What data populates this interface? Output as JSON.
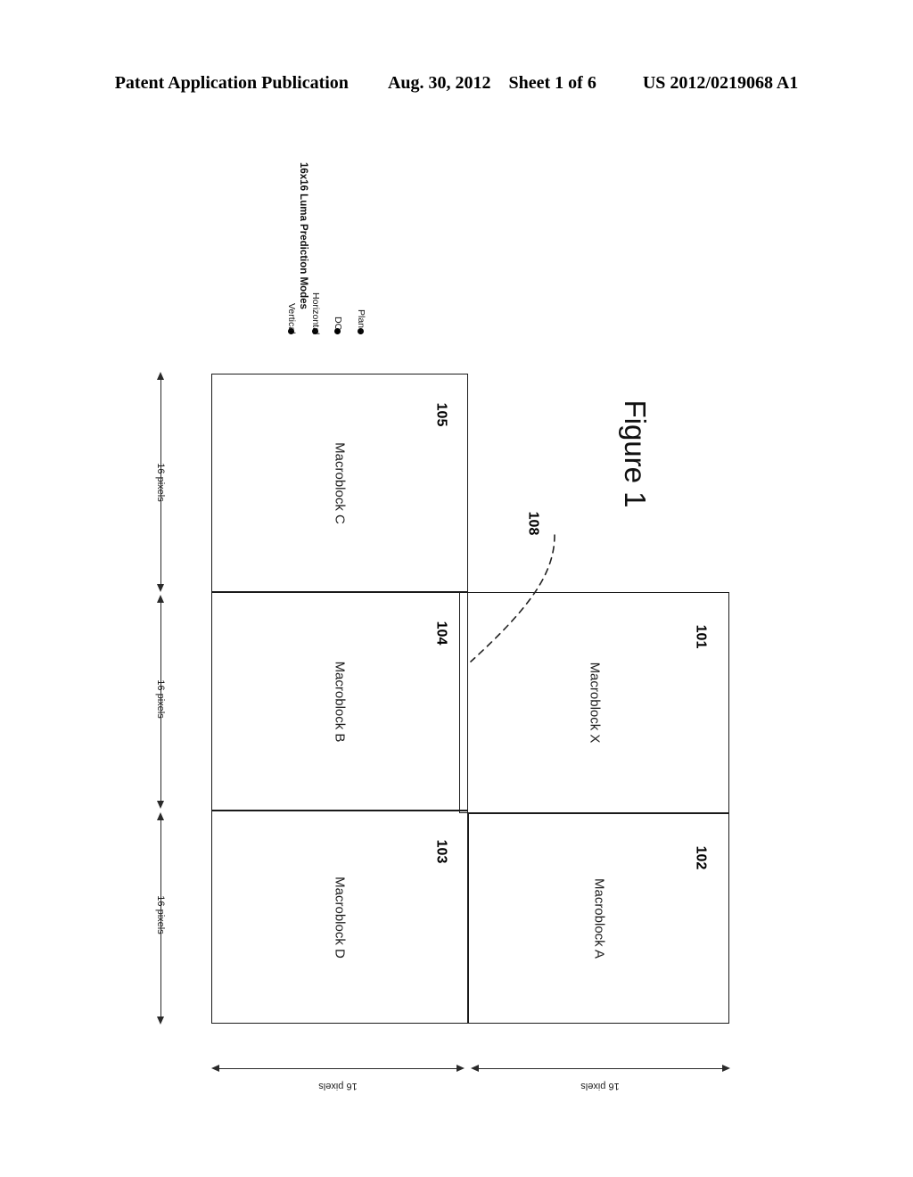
{
  "header": {
    "publication": "Patent Application Publication",
    "date": "Aug. 30, 2012",
    "sheet": "Sheet 1 of 6",
    "docnumber": "US 2012/0219068 A1"
  },
  "figure": {
    "caption": "Figure 1"
  },
  "legend": {
    "title": "16x16 Luma Prediction Modes",
    "items": [
      {
        "label": "Vertical"
      },
      {
        "label": "Horizontal"
      },
      {
        "label": "DC"
      },
      {
        "label": "Plane"
      }
    ]
  },
  "diagram": {
    "blocks": [
      {
        "name": "Macroblock C",
        "ref": "105"
      },
      {
        "name": "Macroblock B",
        "ref": "104"
      },
      {
        "name": "Macroblock D",
        "ref": "103"
      },
      {
        "name": "Macroblock X",
        "ref": "101"
      },
      {
        "name": "Macroblock A",
        "ref": "102"
      }
    ],
    "callout": {
      "ref": "108"
    },
    "dimensions": {
      "vertical": [
        {
          "label": "16 pixels"
        },
        {
          "label": "16 pixels"
        },
        {
          "label": "16 pixels"
        }
      ],
      "horizontal": [
        {
          "label": "16 pixels"
        },
        {
          "label": "16 pixels"
        }
      ]
    }
  },
  "colors": {
    "ink": "#1a1a1a",
    "paper": "#ffffff"
  }
}
